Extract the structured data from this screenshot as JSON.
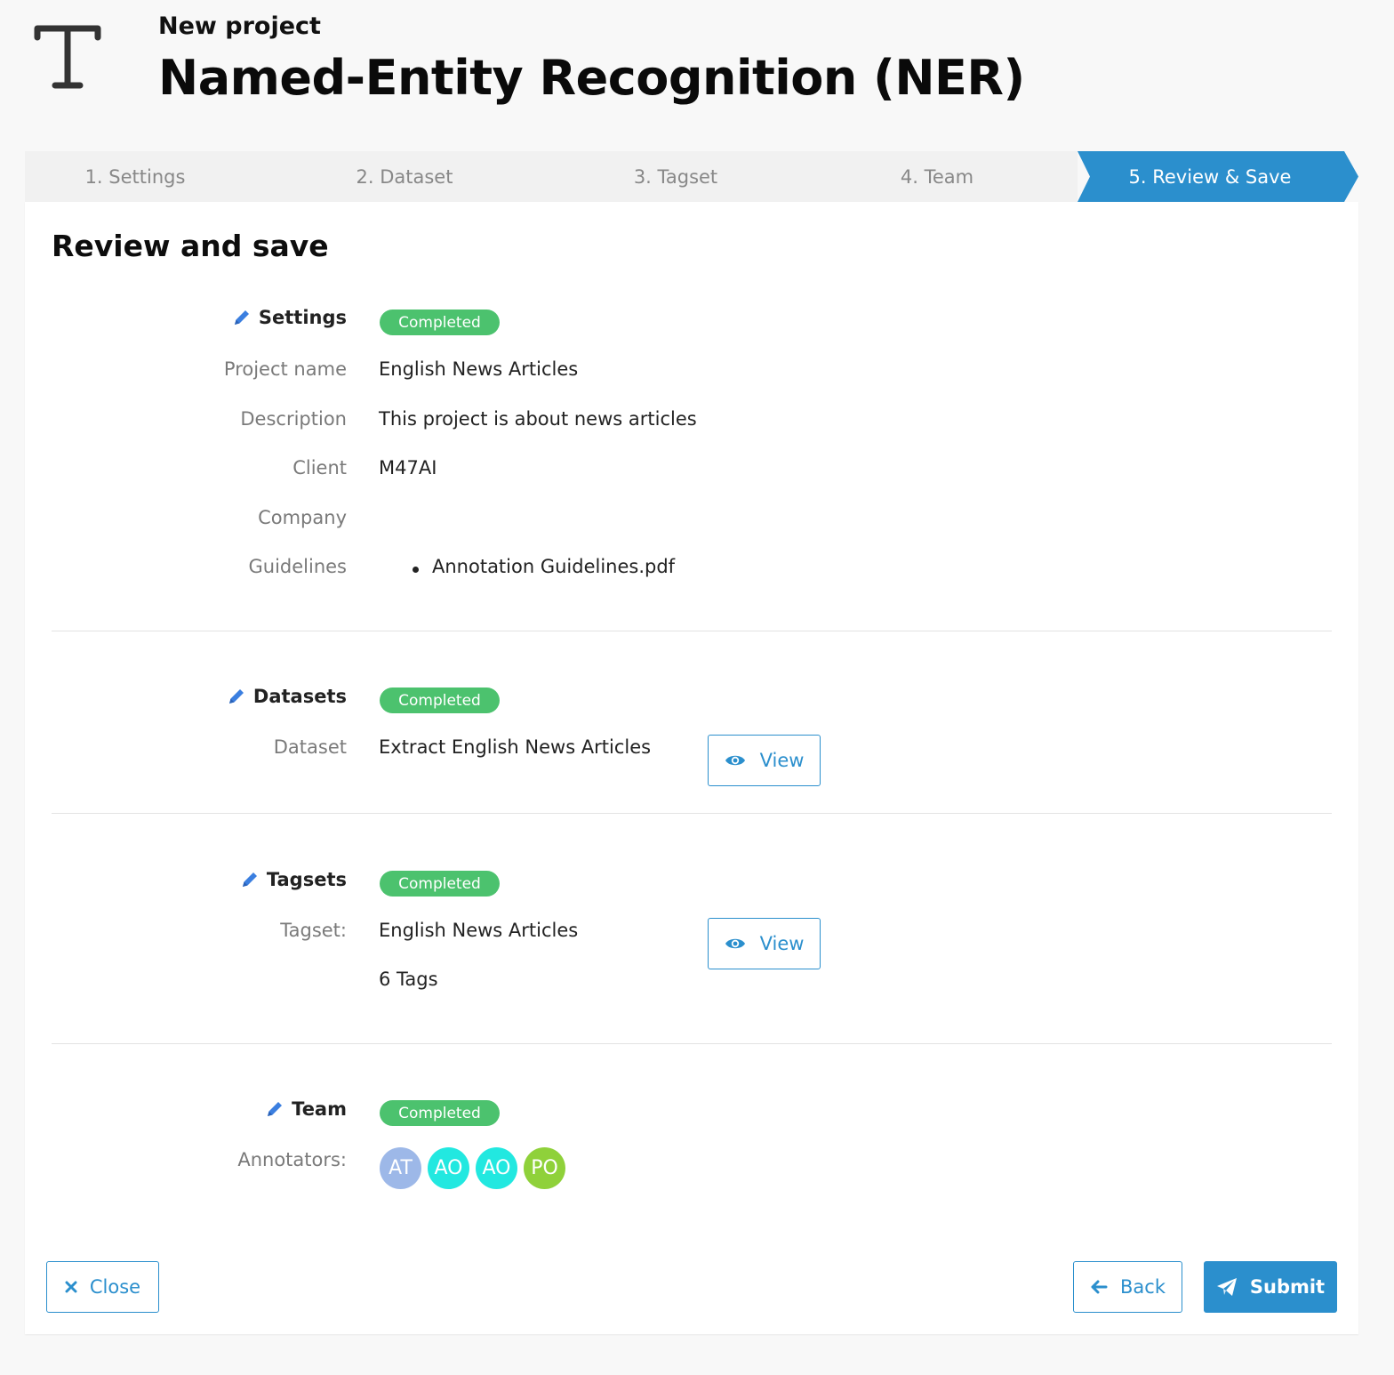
{
  "header": {
    "subtitle": "New project",
    "title": "Named-Entity Recognition (NER)",
    "icon": "text-type-icon"
  },
  "stepper": {
    "steps": [
      {
        "label": "1. Settings",
        "active": false
      },
      {
        "label": "2. Dataset",
        "active": false
      },
      {
        "label": "3. Tagset",
        "active": false
      },
      {
        "label": "4. Team",
        "active": false
      },
      {
        "label": "5. Review & Save",
        "active": true
      }
    ]
  },
  "review": {
    "title": "Review and save",
    "settings": {
      "heading": "Settings",
      "status": "Completed",
      "project_name_label": "Project name",
      "project_name": "English News Articles",
      "description_label": "Description",
      "description": "This project is about news articles",
      "client_label": "Client",
      "client": "M47AI",
      "company_label": "Company",
      "company": "",
      "guidelines_label": "Guidelines",
      "guidelines": [
        "Annotation Guidelines.pdf"
      ]
    },
    "datasets": {
      "heading": "Datasets",
      "status": "Completed",
      "dataset_label": "Dataset",
      "dataset": "Extract English News Articles",
      "view_label": "View"
    },
    "tagsets": {
      "heading": "Tagsets",
      "status": "Completed",
      "tagset_label": "Tagset:",
      "tagset": "English News Articles",
      "tag_count": "6 Tags",
      "view_label": "View"
    },
    "team": {
      "heading": "Team",
      "status": "Completed",
      "annotators_label": "Annotators:",
      "annotators": [
        {
          "initials": "AT",
          "color": "#9db8e8"
        },
        {
          "initials": "AO",
          "color": "#22e8e0"
        },
        {
          "initials": "AO",
          "color": "#22e8e0"
        },
        {
          "initials": "PO",
          "color": "#8fd13a"
        }
      ]
    }
  },
  "footer": {
    "close_label": "Close",
    "back_label": "Back",
    "submit_label": "Submit"
  },
  "colors": {
    "accent": "#2b8fcd",
    "success": "#4cc26e"
  }
}
